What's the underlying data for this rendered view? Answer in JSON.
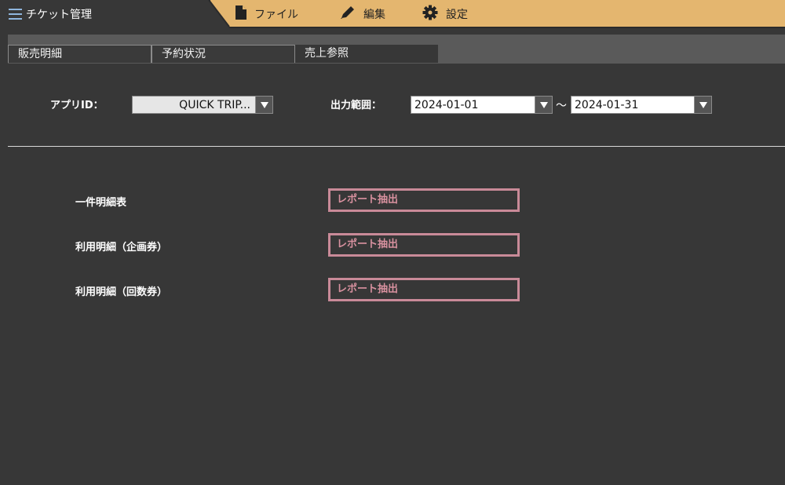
{
  "app": {
    "title": "チケット管理"
  },
  "menu": {
    "file": "ファイル",
    "edit": "編集",
    "settings": "設定"
  },
  "tabs": [
    {
      "label": "販売明細",
      "active": false
    },
    {
      "label": "予約状況",
      "active": false
    },
    {
      "label": "売上参照",
      "active": true
    }
  ],
  "filters": {
    "app_id_label": "アプリID：",
    "app_id_value": "QUICK TRIP...",
    "range_label": "出力範囲：",
    "date_from": "2024-01-01",
    "range_separator": "～",
    "date_to": "2024-01-31"
  },
  "reports": [
    {
      "label": "一件明細表",
      "button": "レポート抽出"
    },
    {
      "label": "利用明細（企画券）",
      "button": "レポート抽出"
    },
    {
      "label": "利用明細（回数券）",
      "button": "レポート抽出"
    }
  ],
  "colors": {
    "accent": "#e4b66f",
    "background": "#373737",
    "report_button": "#c98a98",
    "menu_icon": "#8fb6de"
  },
  "icons": {
    "menu": "hamburger-icon",
    "file": "file-icon",
    "edit": "pencil-icon",
    "settings": "gear-icon",
    "dropdown": "caret-down-icon"
  }
}
